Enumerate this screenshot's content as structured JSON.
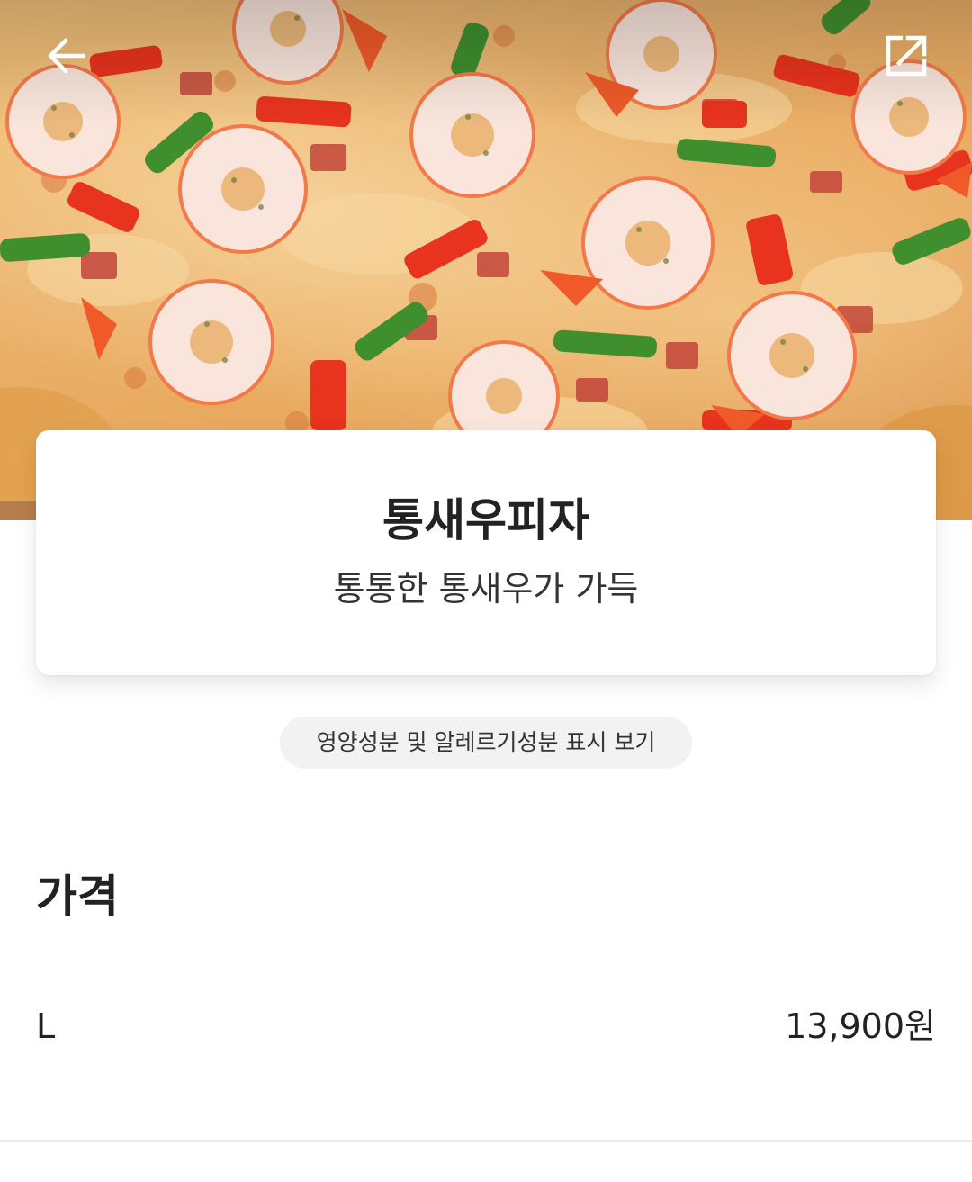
{
  "header": {
    "back_icon": "arrow-left-icon",
    "share_icon": "open-external-icon"
  },
  "hero": {
    "image_subject": "shrimp pizza photo"
  },
  "menu": {
    "name": "통새우피자",
    "description": "통통한 통새우가 가득"
  },
  "nutrition_link": {
    "label": "영양성분 및 알레르기성분 표시 보기"
  },
  "price_section": {
    "heading": "가격",
    "options": [
      {
        "size": "L",
        "price": "13,900원"
      }
    ]
  },
  "colors": {
    "background": "#ffffff",
    "chip_background": "#f2f2f2",
    "text_primary": "#222222",
    "divider": "#ececec"
  }
}
